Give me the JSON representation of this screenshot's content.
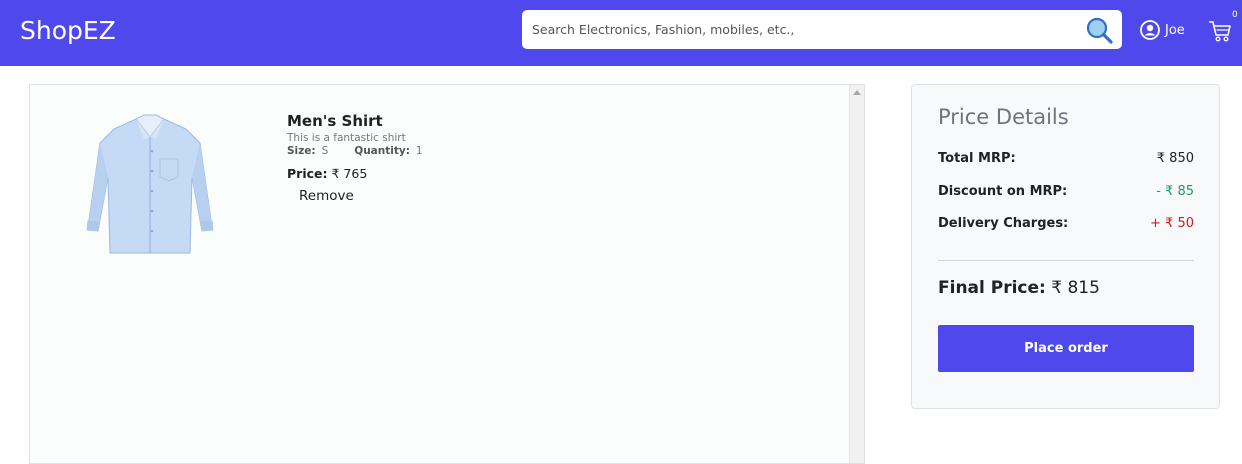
{
  "navbar": {
    "brand": "ShopEZ",
    "search": {
      "placeholder": "Search Electronics, Fashion, mobiles, etc.,",
      "icon": "search-icon"
    },
    "user": {
      "name": "Joe",
      "icon": "user-circle-icon"
    },
    "cart": {
      "icon": "cart-icon",
      "count": "0"
    },
    "color": "#4f48ec"
  },
  "cart": {
    "items": [
      {
        "name": "Men's Shirt",
        "description": "This is a fantastic shirt",
        "size_label": "Size:",
        "size": "S",
        "quantity_label": "Quantity:",
        "quantity": "1",
        "price_label": "Price:",
        "price": "₹ 765",
        "remove_label": "Remove"
      }
    ]
  },
  "price_details": {
    "title": "Price Details",
    "rows": [
      {
        "label": "Total MRP:",
        "value": "₹ 850"
      },
      {
        "label": "Discount on MRP:",
        "value": "- ₹ 85"
      },
      {
        "label": "Delivery Charges:",
        "value": "+ ₹ 50"
      }
    ],
    "final_label": "Final Price:",
    "final_value": "₹ 815",
    "order_button": "Place order"
  }
}
